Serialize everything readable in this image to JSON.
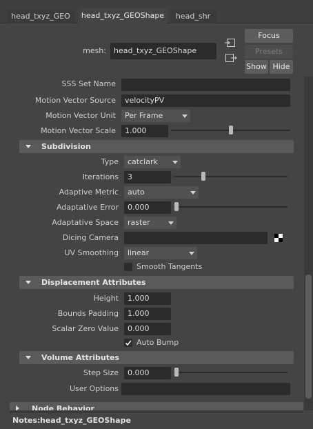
{
  "tabs": [
    "head_txyz_GEO",
    "head_txyz_GEOShape",
    "head_shr"
  ],
  "mesh": {
    "label": "mesh:",
    "value": "head_txyz_GEOShape"
  },
  "buttons": {
    "focus": "Focus",
    "presets": "Presets",
    "show": "Show",
    "hide": "Hide"
  },
  "sss": {
    "label": "SSS Set Name"
  },
  "motion": {
    "source_label": "Motion Vector Source",
    "source_value": "velocityPV",
    "unit_label": "Motion Vector Unit",
    "unit_value": "Per Frame",
    "scale_label": "Motion Vector Scale",
    "scale_value": "1.000",
    "scale_slider_fraction": 0.5
  },
  "subdivision": {
    "title": "Subdivision",
    "type_label": "Type",
    "type_value": "catclark",
    "iterations_label": "Iterations",
    "iterations_value": "3",
    "iterations_slider_fraction": 0.25,
    "metric_label": "Adaptive Metric",
    "metric_value": "auto",
    "error_label": "Adaptative Error",
    "error_value": "0.000",
    "error_slider_fraction": 0.0,
    "space_label": "Adaptative Space",
    "space_value": "raster",
    "camera_label": "Dicing Camera",
    "camera_value": "",
    "uv_label": "UV Smoothing",
    "uv_value": "linear",
    "smooth_label": "Smooth Tangents",
    "smooth_checked": false
  },
  "displacement": {
    "title": "Displacement Attributes",
    "height_label": "Height",
    "height_value": "1.000",
    "bounds_label": "Bounds Padding",
    "bounds_value": "1.000",
    "scalar_label": "Scalar Zero Value",
    "scalar_value": "0.000",
    "autobump_label": "Auto Bump",
    "autobump_checked": true
  },
  "volume": {
    "title": "Volume Attributes",
    "step_label": "Step Size",
    "step_value": "0.000",
    "step_slider_fraction": 0.0,
    "options_label": "User Options",
    "options_value": ""
  },
  "node_behavior": {
    "title": "Node Behavior"
  },
  "notes": {
    "label": "Notes:",
    "value": "head_txyz_GEOShape"
  }
}
